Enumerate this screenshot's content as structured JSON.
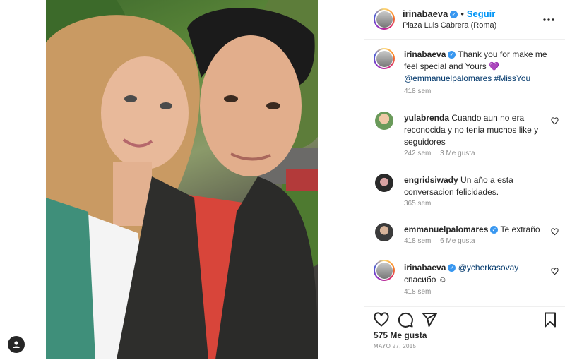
{
  "post": {
    "username": "irinabaeva",
    "follow_label": "Seguir",
    "location": "Plaza Luis Cabrera (Roma)",
    "caption": {
      "text": "Thank you for make me feel special and Yours",
      "emoji": "💜",
      "mention": "@emmanuelpalomares",
      "hashtag": "#MissYou",
      "time": "418 sem"
    },
    "likes": "575 Me gusta",
    "date": "MAYO 27, 2015"
  },
  "comments": [
    {
      "username": "yulabrenda",
      "text": "Cuando aun no era reconocida y no tenia muchos like y seguidores",
      "time": "242 sem",
      "likes": "3 Me gusta"
    },
    {
      "username": "engridsiwady",
      "text": "Un año a esta conversacion felicidades.",
      "time": "365 sem",
      "likes": ""
    },
    {
      "username": "emmanuelpalomares",
      "text": "Te extraño",
      "time": "418 sem",
      "likes": "6 Me gusta"
    },
    {
      "username": "irinabaeva",
      "mention": "@ycherkasovay",
      "text": "спасибо ☺",
      "time": "418 sem",
      "likes": ""
    }
  ],
  "icons": {
    "verified": "verified-badge-icon",
    "more": "more-options-icon",
    "like": "heart-icon",
    "comment": "comment-bubble-icon",
    "share": "paper-plane-icon",
    "save": "bookmark-icon",
    "profile": "profile-avatar-icon"
  },
  "colors": {
    "accent": "#0095f6",
    "verified": "#3897f0",
    "mention": "#00376b",
    "muted": "#8e8e8e"
  }
}
